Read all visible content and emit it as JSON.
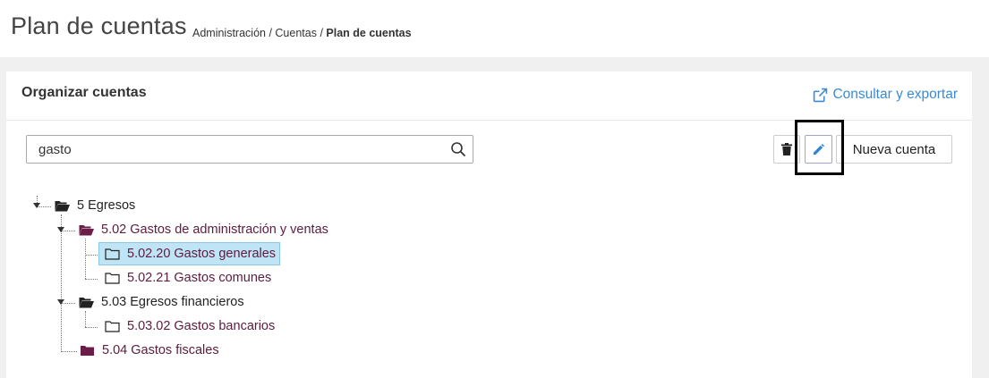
{
  "header": {
    "title": "Plan de cuentas",
    "breadcrumb": {
      "item1": "Administración",
      "sep1": " / ",
      "item2": "Cuentas",
      "sep2": " / ",
      "current": "Plan de cuentas"
    }
  },
  "panel": {
    "title": "Organizar cuentas",
    "export_label": "Consultar y exportar",
    "export_icon": "external-link-icon"
  },
  "search": {
    "value": "gasto",
    "icon": "search-icon"
  },
  "toolbar": {
    "delete_icon": "trash-icon",
    "edit_icon": "pencil-icon",
    "new_label": "Nueva cuenta"
  },
  "tree": {
    "n0": "5 Egresos",
    "n1": "5.02 Gastos de administración y ventas",
    "n2": "5.02.20 Gastos generales",
    "n3": "5.02.21 Gastos comunes",
    "n4": "5.03 Egresos financieros",
    "n5": "5.03.02 Gastos bancarios",
    "n6": "5.04 Gastos fiscales"
  },
  "colors": {
    "accent": "#3b8bd4",
    "selected_bg": "#bfe4f6",
    "node_text_purple": "#5c1b3f",
    "folder_purple": "#6b1d48"
  }
}
